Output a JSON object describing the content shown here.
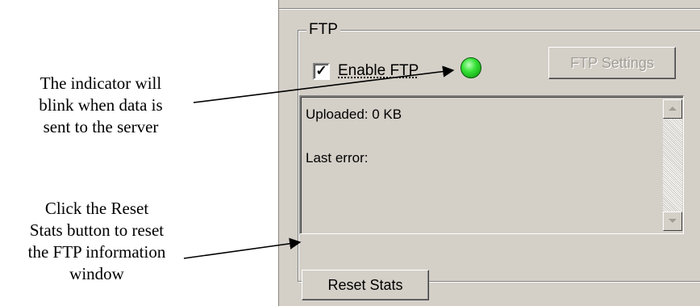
{
  "annotations": {
    "indicator_note": "The indicator will blink when data is sent to the server",
    "indicator_note_lines": [
      "The indicator will",
      "blink when data is",
      "sent to the server"
    ],
    "reset_note_lines": [
      "Click the Reset",
      "Stats button to reset",
      "the FTP information",
      "window"
    ]
  },
  "ftp_group": {
    "title": "FTP",
    "enable_checkbox": {
      "label": "Enable FTP",
      "checked": true,
      "mark": "✓"
    },
    "indicator": {
      "icon": "status-led-icon",
      "color": "#22cc22"
    },
    "settings_button_label": "FTP Settings",
    "info": {
      "uploaded": "Uploaded: 0 KB",
      "last_error": "Last error:"
    },
    "reset_button_label": "Reset Stats"
  },
  "colors": {
    "panel_bg": "#d4d0c8",
    "led_green": "#22cc22"
  }
}
